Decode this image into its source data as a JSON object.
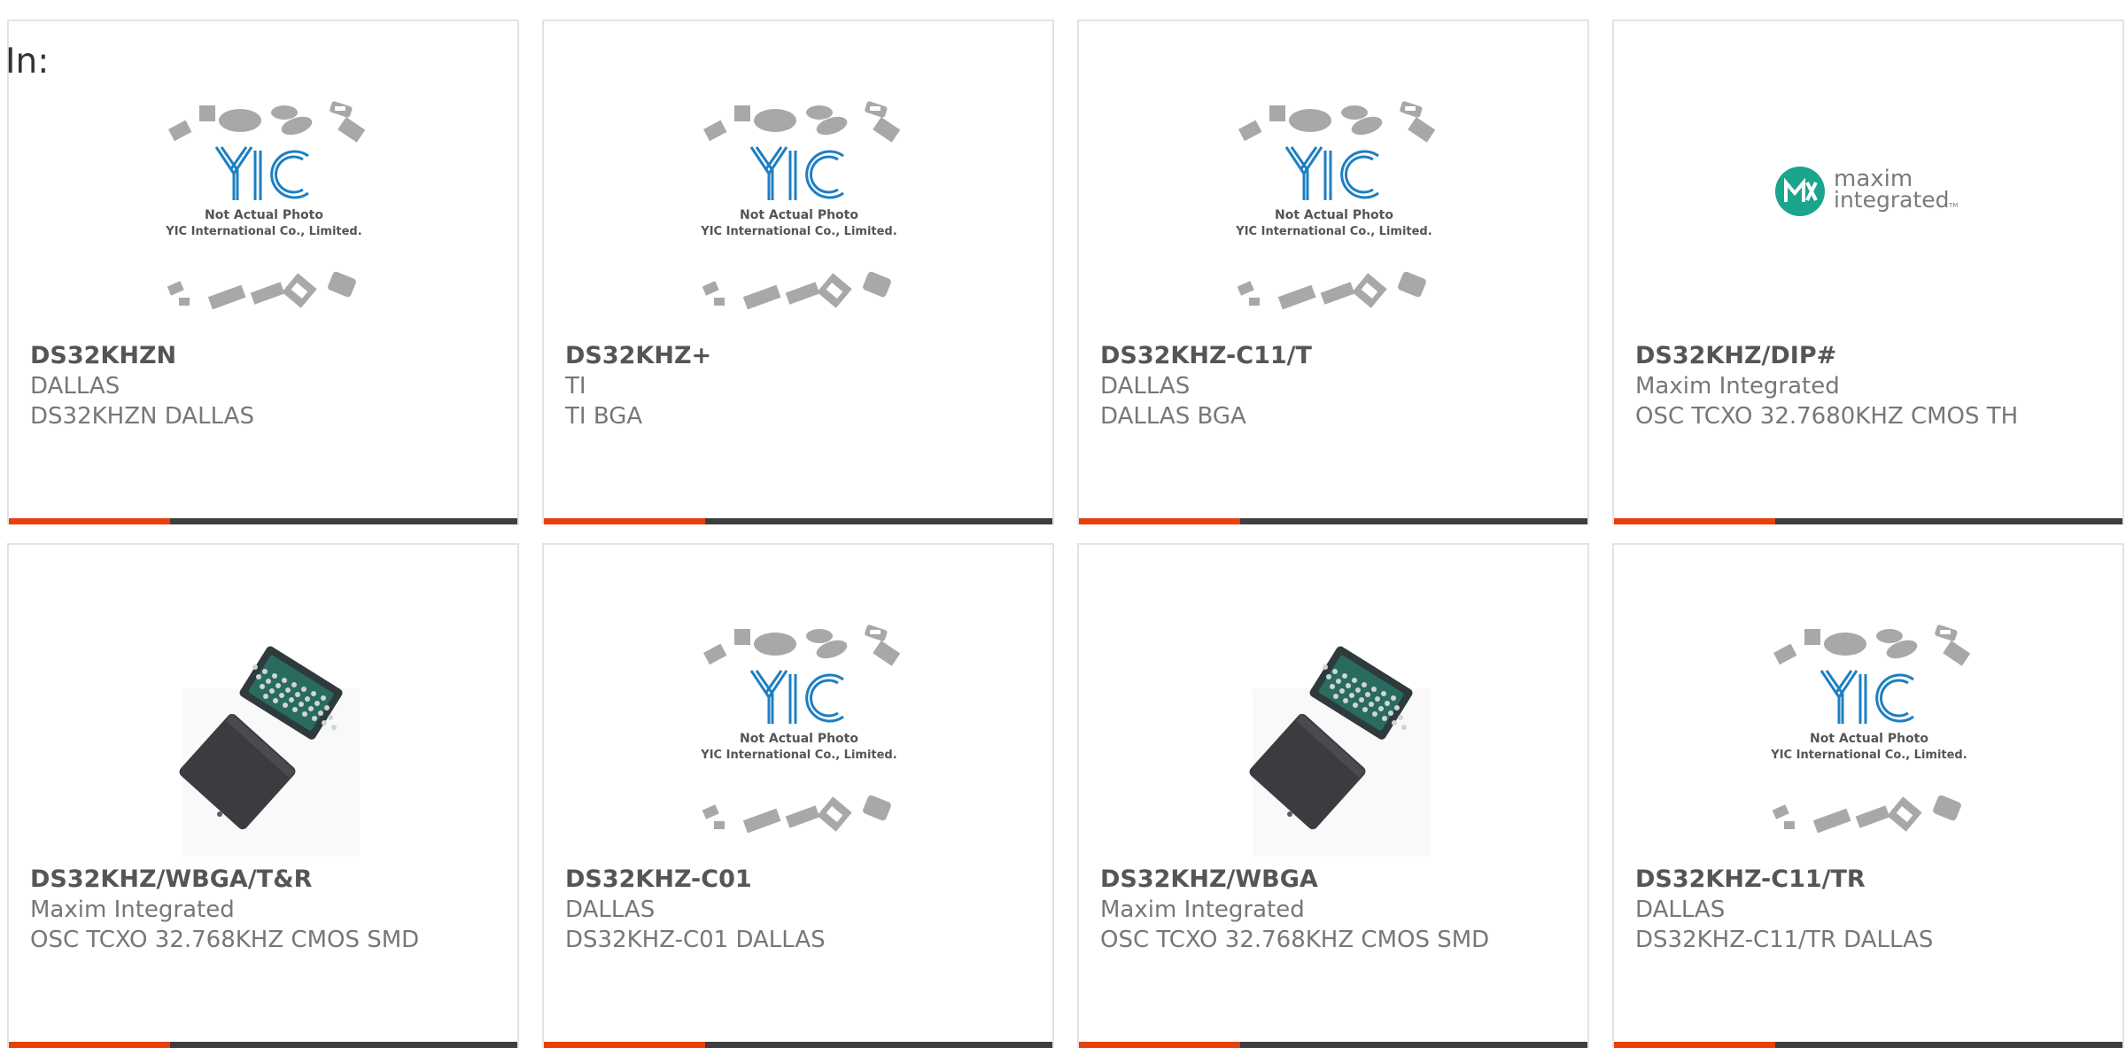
{
  "prefix": "In:",
  "products": [
    {
      "part": "DS32KHZN",
      "mfr": "DALLAS",
      "desc": "DS32KHZN DALLAS",
      "image": "yic-placeholder"
    },
    {
      "part": "DS32KHZ+",
      "mfr": "TI",
      "desc": "TI BGA",
      "image": "yic-placeholder"
    },
    {
      "part": "DS32KHZ-C11/T",
      "mfr": "DALLAS",
      "desc": "DALLAS BGA",
      "image": "yic-placeholder"
    },
    {
      "part": "DS32KHZ/DIP#",
      "mfr": "Maxim Integrated",
      "desc": "OSC TCXO 32.7680KHZ CMOS TH",
      "image": "maxim-logo"
    },
    {
      "part": "DS32KHZ/WBGA/T&R",
      "mfr": "Maxim Integrated",
      "desc": "OSC TCXO 32.768KHZ CMOS SMD",
      "image": "bga-chip"
    },
    {
      "part": "DS32KHZ-C01",
      "mfr": "DALLAS",
      "desc": "DS32KHZ-C01 DALLAS",
      "image": "yic-placeholder"
    },
    {
      "part": "DS32KHZ/WBGA",
      "mfr": "Maxim Integrated",
      "desc": "OSC TCXO 32.768KHZ CMOS SMD",
      "image": "bga-chip"
    },
    {
      "part": "DS32KHZ-C11/TR",
      "mfr": "DALLAS",
      "desc": "DS32KHZ-C11/TR DALLAS",
      "image": "yic-placeholder"
    }
  ],
  "placeholder": {
    "logo": "YIC",
    "line1": "Not Actual Photo",
    "line2": "YIC International Co., Limited."
  },
  "maxim_logo": {
    "line1": "maxim",
    "line2": "integrated",
    "tm": "TM"
  },
  "colors": {
    "accent": "#e8400c",
    "bar": "#3e3e3e",
    "border": "#e3e3e3",
    "text": "#666666",
    "yic_blue": "#1e7fc2",
    "maxim_teal": "#1aa58c"
  }
}
